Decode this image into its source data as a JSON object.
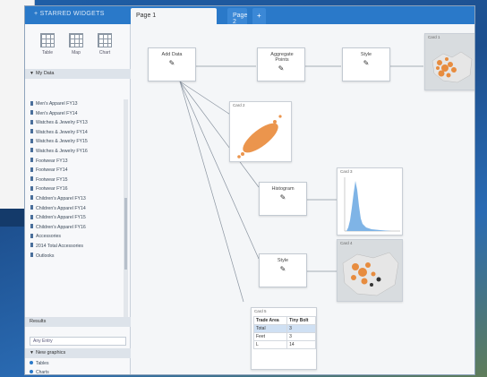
{
  "app": {
    "title": "+ STARRED WIDGETS",
    "tabs": [
      {
        "label": "Page 1",
        "active": true
      },
      {
        "label": "Page 2",
        "active": false
      },
      {
        "label": "+",
        "active": false
      }
    ]
  },
  "sidebar": {
    "tools": [
      {
        "label": "Table",
        "icon": "grid-icon"
      },
      {
        "label": "Map",
        "icon": "map-icon"
      },
      {
        "label": "Chart",
        "icon": "chart-icon"
      }
    ],
    "my_data_header": "My Data",
    "datasets": [
      "Men's Apparel FY13",
      "Men's Apparel FY14",
      "Watches & Jewelry FY13",
      "Watches & Jewelry FY14",
      "Watches & Jewelry FY15",
      "Watches & Jewelry FY16",
      "Footwear FY13",
      "Footwear FY14",
      "Footwear FY15",
      "Footwear FY16",
      "Children's Apparel FY13",
      "Children's Apparel FY14",
      "Children's Apparel FY15",
      "Children's Apparel FY16",
      "Accessories",
      "2014 Total Accessories",
      "Outlooks"
    ],
    "results_header": "Results",
    "filter_placeholder": "Any Entry",
    "viz_header": "New graphics",
    "viz_items": [
      "Tables",
      "Charts"
    ]
  },
  "canvas": {
    "nodes": {
      "add_data": "Add Data",
      "aggregate": "Aggregate Points",
      "style1": "Style",
      "histogram": "Histogram",
      "style2": "Style"
    },
    "cards": {
      "card1": "Card 1",
      "card2": "Card 2",
      "card3": "Card 3",
      "card4": "Card 4",
      "card5": "Card 5"
    },
    "table": {
      "headers": [
        "Trade Area",
        "Tiny Bolt"
      ],
      "rows": [
        [
          "Total",
          "3"
        ],
        [
          "Feet",
          "3"
        ],
        [
          "L",
          "14"
        ]
      ]
    }
  },
  "colors": {
    "accent": "#2a79c9",
    "orange": "#e8832e",
    "histogram_blue": "#7fb4e6"
  }
}
